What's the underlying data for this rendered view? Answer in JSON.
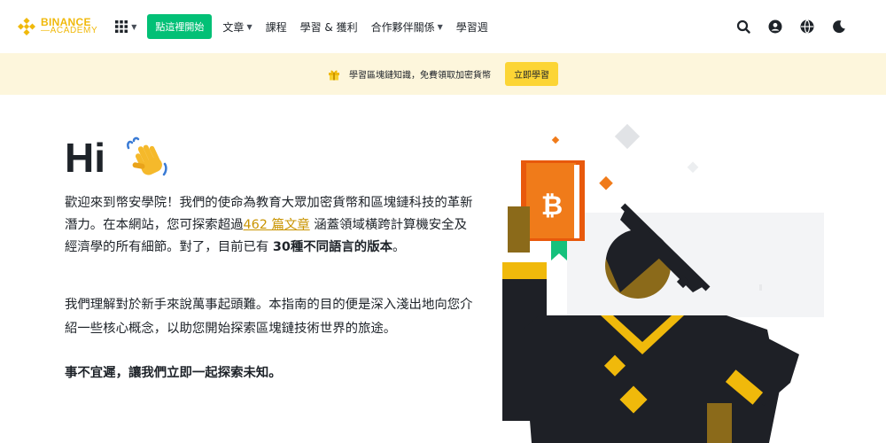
{
  "nav": {
    "brand": "BINANCE",
    "brand_sub": "ACADEMY",
    "cta_label": "點這裡開始",
    "menu": [
      {
        "label": "文章",
        "has_caret": true
      },
      {
        "label": "課程",
        "has_caret": false
      },
      {
        "label": "學習 & 獲利",
        "has_caret": false
      },
      {
        "label": "合作夥伴關係",
        "has_caret": true
      },
      {
        "label": "學習週",
        "has_caret": false
      }
    ],
    "icons": [
      "search-icon",
      "account-icon",
      "language-icon",
      "dark-mode-icon"
    ]
  },
  "banner": {
    "text": "學習區塊鏈知識，免費領取加密貨幣",
    "button": "立即學習"
  },
  "intro": {
    "greeting": "Hi",
    "p1_start": "歡迎來到幣安學院！我們的使命為教育大眾加密貨幣和區塊鏈科技的革新潛力。在本網站，您可探索超過",
    "p1_link": "462 篇文章",
    "p1_mid": " 涵蓋領域橫跨計算機安全及經濟學的所有細節。對了，目前已有 ",
    "p1_bold": "30種不同語言的版本",
    "p1_end": "。",
    "p2": "我們理解對於新手來說萬事起頭難。本指南的目的便是深入淺出地向您介紹一些核心概念，以助您開始探索區塊鏈技術世界的旅途。",
    "p3": "事不宜遲，讓我們立即一起探索未知。"
  },
  "colors": {
    "brand": "#f0b90b",
    "cta": "#02c076",
    "banner_bg": "#fdf6dc",
    "banner_btn": "#fcd535",
    "link": "#c99400",
    "book": "#e8590c"
  }
}
